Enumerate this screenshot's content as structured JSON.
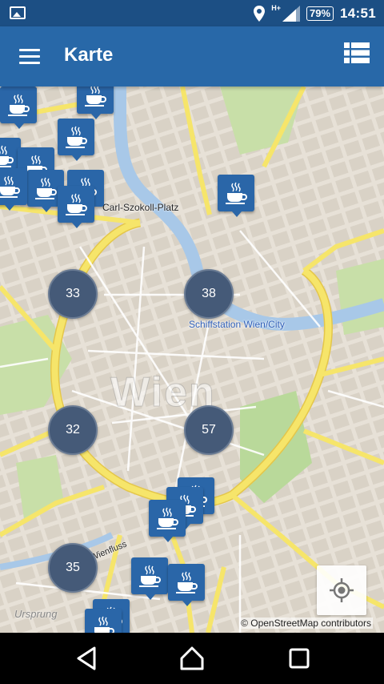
{
  "status_bar": {
    "network": "H+",
    "battery": "79%",
    "time": "14:51",
    "icons": [
      "image-icon",
      "location-icon",
      "signal-icon",
      "battery-icon"
    ]
  },
  "app_bar": {
    "title": "Karte",
    "icons": [
      "menu-icon",
      "list-icon"
    ]
  },
  "map": {
    "city_label": "Wien",
    "labels": {
      "square": "Carl-Szokoll-Platz",
      "station": "Schiffstation Wien/City",
      "street": "Wienfluss",
      "poi": "Ursprung"
    },
    "clusters": [
      {
        "count": "33"
      },
      {
        "count": "38"
      },
      {
        "count": "32"
      },
      {
        "count": "57"
      },
      {
        "count": "35"
      }
    ],
    "marker_icon": "coffee-cup-icon",
    "attribution": "© OpenStreetMap contributors"
  },
  "colors": {
    "status_bar": "#1c4f84",
    "app_bar": "#2868a8",
    "marker": "#2a66a8",
    "cluster": "#455a78",
    "water": "#a8c8e8",
    "road": "#f6e56a"
  },
  "nav_bar": {
    "icons": [
      "back-icon",
      "home-icon",
      "recents-icon"
    ]
  }
}
